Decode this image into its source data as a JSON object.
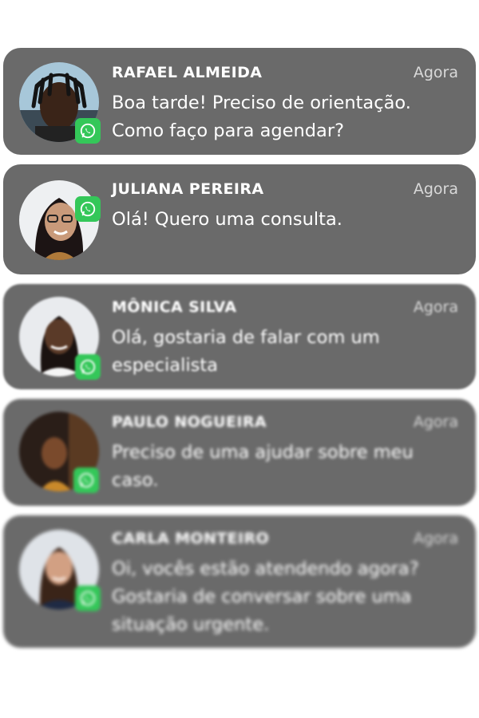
{
  "notifications": [
    {
      "name": "RAFAEL ALMEIDA",
      "time": "Agora",
      "message": "Boa tarde! Preciso de orientação. Como faço para agendar?",
      "app_icon": "whatsapp-icon"
    },
    {
      "name": "JULIANA PEREIRA",
      "time": "Agora",
      "message": "Olá! Quero uma consulta.",
      "app_icon": "whatsapp-icon"
    },
    {
      "name": "MÔNICA SILVA",
      "time": "Agora",
      "message": "Olá, gostaria de falar com um especialista",
      "app_icon": "whatsapp-icon"
    },
    {
      "name": "PAULO NOGUEIRA",
      "time": "Agora",
      "message": "Preciso de uma ajudar sobre meu caso.",
      "app_icon": "whatsapp-icon"
    },
    {
      "name": "CARLA MONTEIRO",
      "time": "Agora",
      "message": "Oi, vocês estão atendendo agora? Gostaria de conversar sobre uma situação urgente.",
      "app_icon": "whatsapp-icon"
    }
  ],
  "colors": {
    "card_background": "#6a6a6a",
    "whatsapp_green": "#34c759",
    "time_text": "#d9d9d9"
  }
}
